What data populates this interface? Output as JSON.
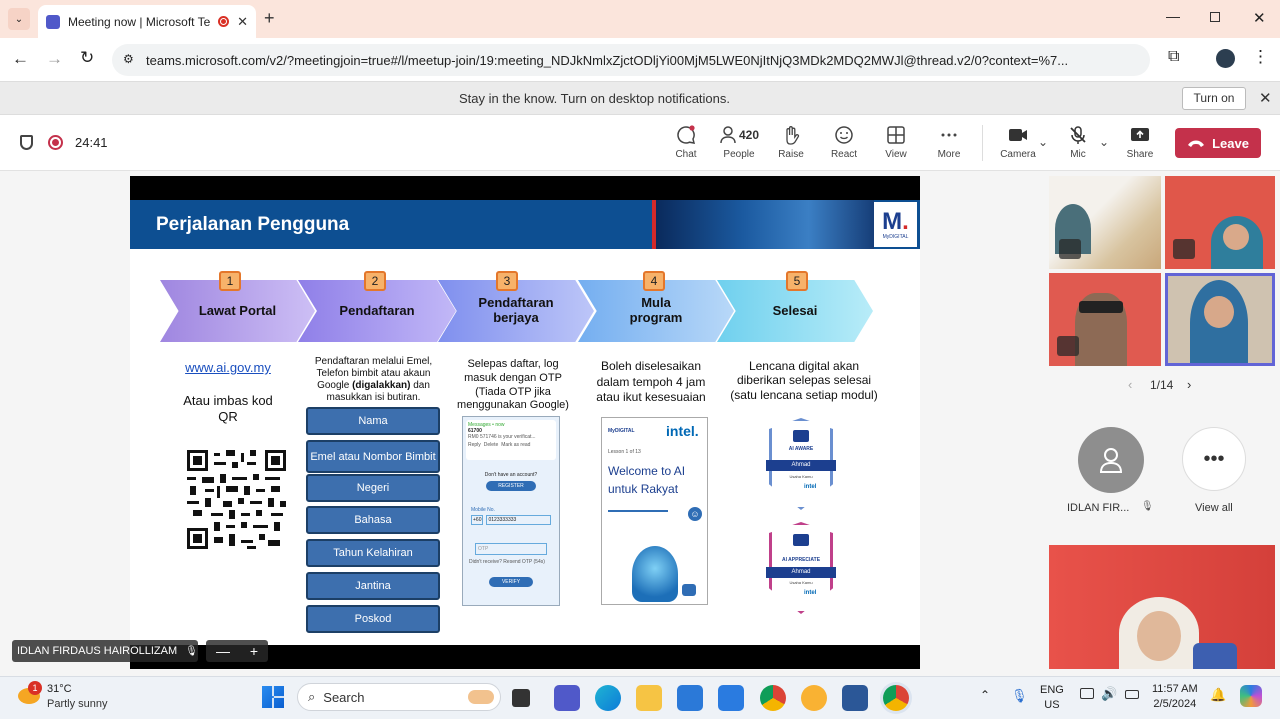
{
  "browser": {
    "tab_title": "Meeting now | Microsoft Te",
    "url": "teams.microsoft.com/v2/?meetingjoin=true#/l/meetup-join/19:meeting_NDJkNmlxZjctODljYi00MjM5LWE0NjItNjQ3MDk2MDQ2MWJl@thread.v2/0?context=%7...",
    "notification": "Stay in the know. Turn on desktop notifications.",
    "turn_on_label": "Turn on"
  },
  "meeting": {
    "timer": "24:41",
    "toolbar": {
      "chat": "Chat",
      "people_count": "420",
      "people": "People",
      "raise": "Raise",
      "react": "React",
      "view": "View",
      "more": "More",
      "camera": "Camera",
      "mic": "Mic",
      "share": "Share",
      "leave": "Leave"
    },
    "presenter_name": "IDLAN FIRDAUS HAIROLLIZAM"
  },
  "slide": {
    "title": "Perjalanan Pengguna",
    "logo_text": "MyDIGITAL",
    "steps": [
      {
        "num": "1",
        "label": "Lawat Portal",
        "color": "#b79be6"
      },
      {
        "num": "2",
        "label": "Pendaftaran",
        "color": "#a89af0"
      },
      {
        "num": "3",
        "label": "Pendaftaran berjaya",
        "color": "#9aa6f2"
      },
      {
        "num": "4",
        "label": "Mula program",
        "color": "#90c0f2"
      },
      {
        "num": "5",
        "label": "Selesai",
        "color": "#8fdcf0"
      }
    ],
    "col1": {
      "link": "www.ai.gov.my",
      "text": "Atau imbas kod QR"
    },
    "col2": {
      "text_a": "Pendaftaran melalui Emel, Telefon bimbit atau akaun Google ",
      "text_b": "(digalakkan)",
      "text_c": " dan masukkan isi butiran.",
      "fields": [
        "Nama",
        "Emel atau Nombor Bimbit",
        "Negeri",
        "Bahasa",
        "Tahun Kelahiran",
        "Jantina",
        "Poskod"
      ]
    },
    "col3": {
      "text": "Selepas daftar, log masuk dengan OTP (Tiada OTP jika menggunakan Google)",
      "phone": {
        "messages": "Messages • now",
        "code": "61700",
        "otp_text": "RM0 571746 is your verificat...",
        "reply": "Reply",
        "delete": "Delete",
        "mark": "Mark as read",
        "no_account": "Don't have an account?",
        "register": "REGISTER",
        "mobile_label": "Mobile No.",
        "mobile_prefix": "+60",
        "mobile_value": "0123333333",
        "otp_placeholder": "OTP",
        "resend": "Didn't receive? Resend OTP (54s)",
        "verify": "VERIFY"
      }
    },
    "col4": {
      "text": "Boleh diselesaikan dalam tempoh 4 jam atau ikut kesesuaian",
      "card_brand": "MyDIGITAL",
      "card_intel": "intel.",
      "lesson": "Lesson 1 of 13",
      "welcome": "Welcome to AI untuk Rakyat"
    },
    "col5": {
      "text": "Lencana digital akan diberikan selepas selesai (satu lencana setiap modul)",
      "badge1_label": "AI AWARE",
      "badge2_label": "AI APPRECIATE",
      "badge_name": "Ahmad",
      "badge_sub": "Usaha Kamu",
      "badge_intel": "intel"
    }
  },
  "side": {
    "page": "1/14",
    "participant_name": "IDLAN FIR...",
    "view_all": "View all"
  },
  "taskbar": {
    "temp": "31°C",
    "weather": "Partly sunny",
    "weather_badge": "1",
    "search": "Search",
    "lang_top": "ENG",
    "lang_bottom": "US",
    "time": "11:57 AM",
    "date": "2/5/2024"
  }
}
